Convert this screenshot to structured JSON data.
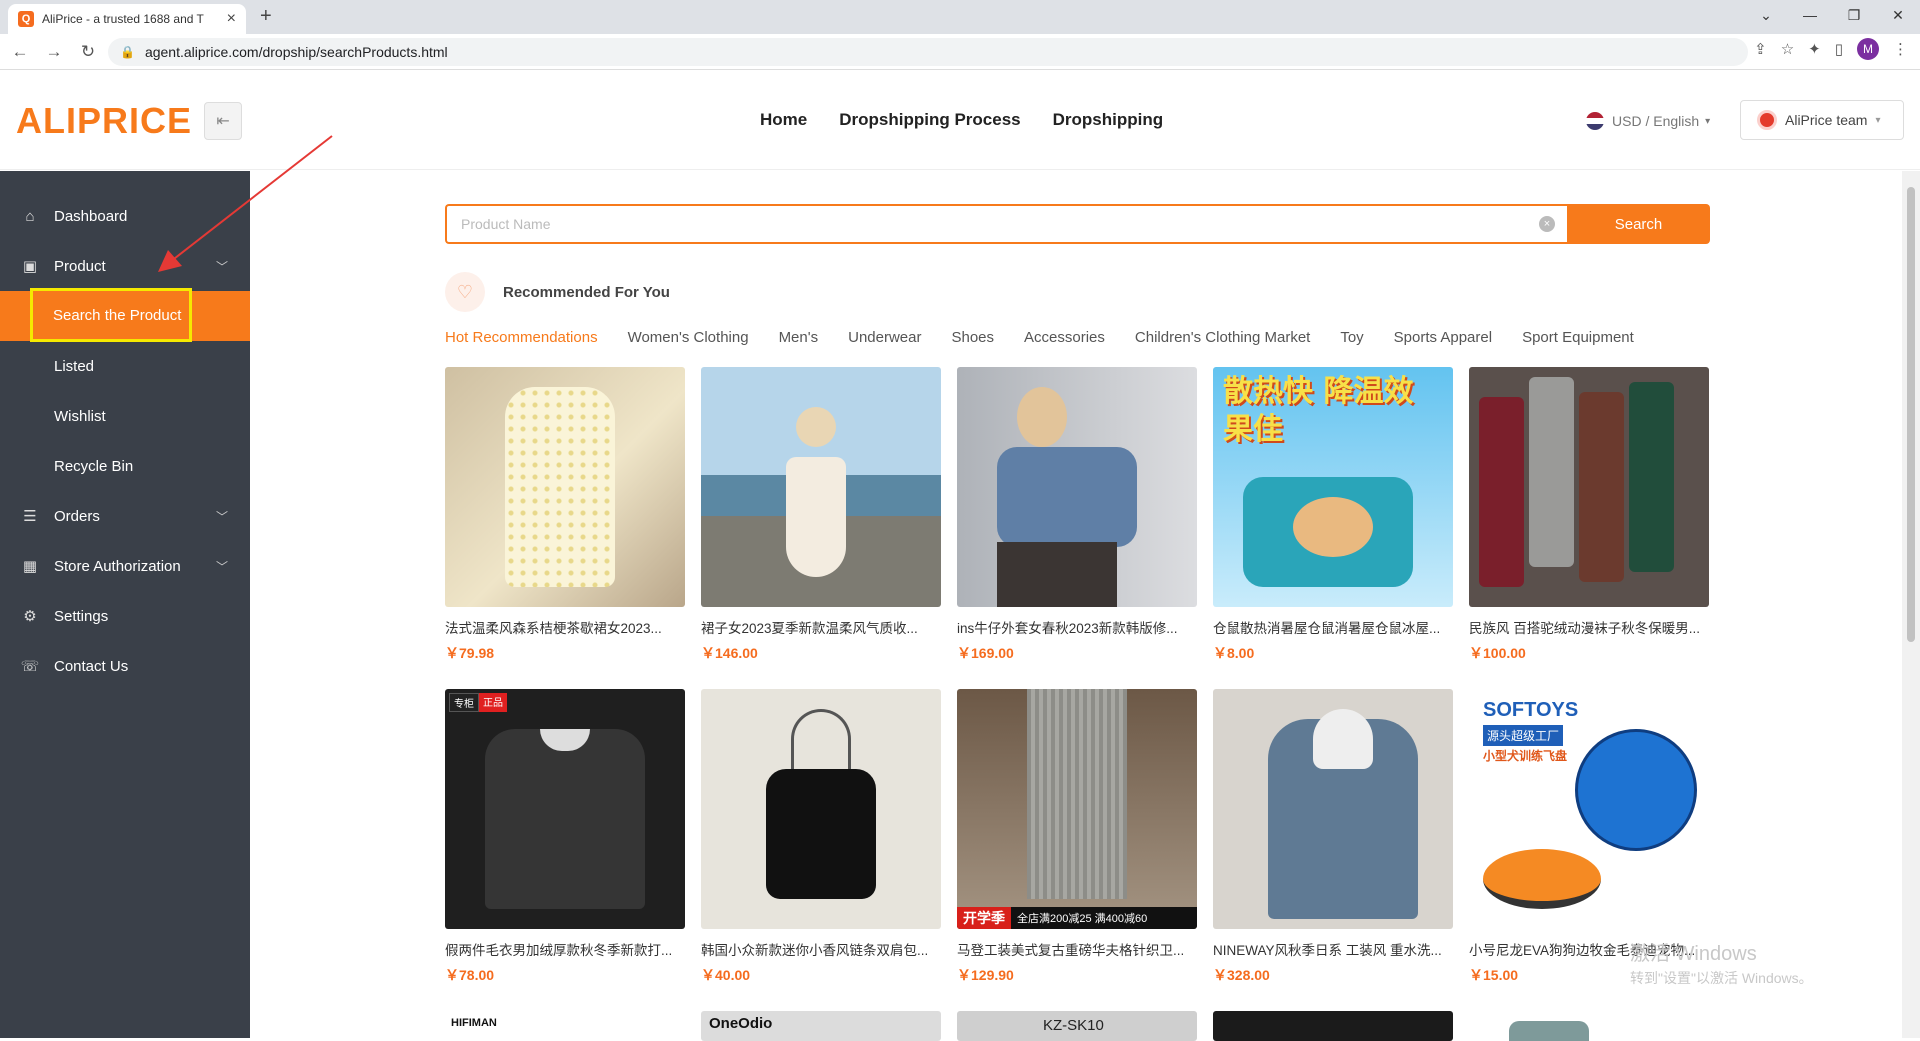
{
  "browser": {
    "tab_title": "AliPrice - a trusted 1688 and T",
    "url": "agent.aliprice.com/dropship/searchProducts.html",
    "profile_initial": "M"
  },
  "header": {
    "logo": "ALIPRICE",
    "nav": [
      "Home",
      "Dropshipping Process",
      "Dropshipping"
    ],
    "currency": "USD / English",
    "team": "AliPrice team"
  },
  "sidebar": {
    "dashboard": "Dashboard",
    "product": "Product",
    "search_product": "Search the Product",
    "listed": "Listed",
    "wishlist": "Wishlist",
    "recycle_bin": "Recycle Bin",
    "orders": "Orders",
    "store_auth": "Store Authorization",
    "settings": "Settings",
    "contact": "Contact Us"
  },
  "search": {
    "placeholder": "Product Name",
    "button": "Search"
  },
  "recommend": {
    "title": "Recommended For You",
    "categories": [
      "Hot Recommendations",
      "Women's Clothing",
      "Men's",
      "Underwear",
      "Shoes",
      "Accessories",
      "Children's Clothing Market",
      "Toy",
      "Sports Apparel",
      "Sport Equipment"
    ]
  },
  "products": [
    {
      "name": "法式温柔风森系桔梗茶歇裙女2023...",
      "price": "￥79.98",
      "bg": "#d9c9a8"
    },
    {
      "name": "裙子女2023夏季新款温柔风气质收...",
      "price": "￥146.00",
      "bg": "#9cc2d8"
    },
    {
      "name": "ins牛仔外套女春秋2023新款韩版修...",
      "price": "￥169.00",
      "bg": "#c4c7cc"
    },
    {
      "name": "仓鼠散热消暑屋仓鼠消暑屋仓鼠冰屋...",
      "price": "￥8.00",
      "bg": "#4fb3e6"
    },
    {
      "name": "民族风 百搭驼绒动漫袜子秋冬保暖男...",
      "price": "￥100.00",
      "bg": "#6b5f5a"
    },
    {
      "name": "假两件毛衣男加绒厚款秋冬季新款打...",
      "price": "￥78.00",
      "bg": "#2d2d2d"
    },
    {
      "name": "韩国小众新款迷你小香风链条双肩包...",
      "price": "￥40.00",
      "bg": "#e8e4dc"
    },
    {
      "name": "马登工装美式复古重磅华夫格针织卫...",
      "price": "￥129.90",
      "bg": "#8a7d6e"
    },
    {
      "name": "NINEWAY风秋季日系 工装风 重水洗...",
      "price": "￥328.00",
      "bg": "#d6d2cc"
    },
    {
      "name": "小号尼龙EVA狗狗边牧金毛泰迪宠物...",
      "price": "￥15.00",
      "bg": "#ffffff"
    }
  ],
  "partial_row": [
    "HIFIMAN",
    "OneOdio",
    "KZ-SK10",
    "",
    ""
  ],
  "badges": {
    "sweater_tag1": "专柜",
    "sweater_tag2": "正品",
    "pants_promo1": "开学季",
    "pants_promo2": "全店满200减25 满400减60",
    "toy_brand": "SOFTOYS",
    "toy_sub1": "源头超级工厂",
    "toy_sub2": "小型犬训练飞盘",
    "hamster_text": "散热快 降温效果佳"
  },
  "watermark": {
    "line1": "激活 Windows",
    "line2": "转到\"设置\"以激活 Windows。"
  },
  "colors": {
    "accent": "#f77a1b",
    "sidebar": "#3a4049",
    "highlight": "#f5e900",
    "arrow": "#e53935"
  }
}
